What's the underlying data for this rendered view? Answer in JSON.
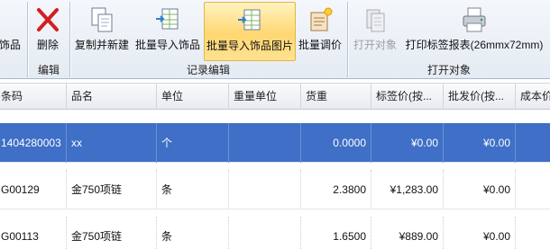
{
  "ribbon": {
    "groups": [
      {
        "label": "编辑"
      },
      {
        "label": "记录编辑"
      },
      {
        "label": "打开对象"
      }
    ],
    "buttons": [
      {
        "label": "饰品"
      },
      {
        "label": "删除"
      },
      {
        "label": "复制并新建"
      },
      {
        "label": "批量导入饰品"
      },
      {
        "label": "批量导入饰品图片",
        "active": true
      },
      {
        "label": "批量调价"
      },
      {
        "label": "打开对象",
        "disabled": true
      },
      {
        "label": "打印标签报表(26mmx72mm)"
      }
    ]
  },
  "grid": {
    "columns": [
      "条码",
      "品名",
      "单位",
      "重量单位",
      "货重",
      "标签价(按...",
      "批发价(按...",
      "成本价"
    ],
    "rows": [
      {
        "barcode": "1404280003",
        "name": "xx",
        "unit": "个",
        "weight_unit": "",
        "weight": "0.0000",
        "tag_price": "¥0.00",
        "wholesale": "¥0.00",
        "cost": "",
        "selected": true
      },
      {
        "barcode": "G00129",
        "name": "金750项链",
        "unit": "条",
        "weight_unit": "",
        "weight": "2.3800",
        "tag_price": "¥1,283.00",
        "wholesale": "¥0.00",
        "cost": ""
      },
      {
        "barcode": "G00113",
        "name": "金750项链",
        "unit": "条",
        "weight_unit": "",
        "weight": "1.6500",
        "tag_price": "¥889.00",
        "wholesale": "¥0.00",
        "cost": ""
      }
    ]
  },
  "colors": {
    "selection": "#3f6fc6",
    "active_button": "#ffd772"
  }
}
